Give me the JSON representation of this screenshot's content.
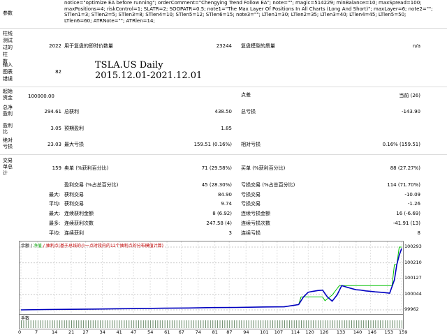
{
  "params": {
    "label": "参数",
    "text": "notice=\"optimize EA before running\"; orderComment=\"Chengying Trend Follow EA\"; note=\"\"; magic=514229; minBalance=10; maxSpread=100;\nmaxPositions=4; riskControl=1; SLATR=2; SOOPATR=0.5; note1=\"The Max Layer Of Positions In All Charts (Long And Short)\"; maxLayer=6; note2=\"\";\nSTlen1=3; STlen2=5; STlen3=8; STlen4=10; STlen5=12; STlen6=15; note3=\"\"; LTlen1=30; LTlen2=35; LTlen3=40; LTlen4=45; LTlen5=50;\nLTlen6=60; ATRNote=\"\"; ATRlen=14;"
  },
  "overlay": {
    "line1": "TSLA.US Daily",
    "line2": "2015.12.01-2021.12.01"
  },
  "rows": {
    "bars_label": "柱线\n测试\n过的\n柱\n数",
    "bars_value": "2022",
    "ticks_label": "用于复盘的即时价数量",
    "ticks_value": "23244",
    "quality_label": "复盘模型的质量",
    "quality_value": "n/a",
    "errors_label": "输入\n图表\n错误",
    "errors_value": "82",
    "deposit_label": "起始\n资金",
    "deposit_value": "100000.00",
    "spread_label": "点差",
    "spread_value": "当前 (26)",
    "net_label": "总净\n盈利",
    "net_value": "294.61",
    "gross_profit_label": "总获利",
    "gross_profit_value": "438.50",
    "gross_loss_label": "总亏损",
    "gross_loss_value": "-143.90",
    "pf_label": "盈利\n比",
    "pf_value": "3.05",
    "expected_label": "预期盈利",
    "expected_value": "1.85",
    "absdd_label": "绝对\n亏损",
    "absdd_value": "23.03",
    "maxdd_label": "最大亏损",
    "maxdd_value": "159.51 (0.16%)",
    "reldd_label": "相对亏损",
    "reldd_value": "0.16% (159.51)",
    "trades_label": "交易\n单总\n计",
    "trades_value": "159",
    "short_label": "卖单 (%获利百分比)",
    "short_value": "71 (29.58%)",
    "long_label": "买单 (%获利百分比)",
    "long_value": "88 (27.27%)",
    "profit_trades_label": "盈利交易 (%占总百分比)",
    "profit_trades_value": "45 (28.30%)",
    "loss_trades_label": "亏损交易 (%占总百分比)",
    "loss_trades_value": "114 (71.70%)",
    "largest_label": "最大:",
    "largest_profit_label": "获利交易",
    "largest_profit_value": "84.90",
    "largest_loss_label": "亏损交易",
    "largest_loss_value": "-10.09",
    "average_label": "平均:",
    "avg_profit_label": "获利交易",
    "avg_profit_value": "9.74",
    "avg_loss_label": "亏损交易",
    "avg_loss_value": "-1.26",
    "maxcons_label": "最大:",
    "maxcons_win_label": "连续获利金额",
    "maxcons_win_value": "8 (6.92)",
    "maxcons_loss_label": "连续亏损金额",
    "maxcons_loss_value": "16 (-6.69)",
    "maximal_label": "最多:",
    "maximal_win_label": "连续获利次数",
    "maximal_win_value": "247.58 (4)",
    "maximal_loss_label": "连续亏损次数",
    "maximal_loss_value": "-41.91 (13)",
    "avgcons_label": "平均:",
    "avgcons_win_label": "连续获利",
    "avgcons_win_value": "3",
    "avgcons_loss_label": "连续亏损",
    "avgcons_loss_value": "8"
  },
  "chart": {
    "legend_prefix": "余额 / ",
    "legend_equity": "净值",
    "legend_rest": " / 抽利点(基于总线的小一点时段内的12个抽利点的分布模值计算)",
    "volume_label": "手数"
  },
  "chart_data": {
    "type": "line",
    "y_ticks": [
      "100293",
      "100210",
      "100127",
      "100044",
      "99962"
    ],
    "x_ticks": [
      "0",
      "7",
      "14",
      "21",
      "27",
      "34",
      "41",
      "47",
      "54",
      "61",
      "67",
      "74",
      "81",
      "87",
      "94",
      "101",
      "107",
      "114",
      "120",
      "126",
      "133",
      "140",
      "146",
      "153",
      "159"
    ],
    "ylim": [
      99962,
      100293
    ],
    "xlim": [
      0,
      159
    ],
    "series": [
      {
        "name": "余额",
        "color": "#0000c0",
        "x": [
          0,
          10,
          20,
          30,
          40,
          50,
          60,
          70,
          80,
          90,
          100,
          110,
          116,
          118,
          120,
          122,
          124,
          126,
          128,
          130,
          132,
          134,
          136,
          138,
          140,
          142,
          144,
          146,
          148,
          150,
          152,
          154,
          156,
          157,
          158,
          159
        ],
        "y": [
          99962,
          99964,
          99965,
          99966,
          99968,
          99969,
          99971,
          99972,
          99974,
          99975,
          99977,
          99978,
          99990,
          100030,
          100055,
          100060,
          100064,
          100066,
          100030,
          100008,
          100040,
          100090,
          100082,
          100075,
          100068,
          100066,
          100062,
          100060,
          100057,
          100055,
          100053,
          100050,
          100120,
          100200,
          100250,
          100285
        ]
      },
      {
        "name": "净值",
        "color": "#00c000",
        "x": [
          0,
          10,
          20,
          30,
          40,
          50,
          60,
          70,
          80,
          90,
          100,
          110,
          116,
          117,
          120,
          126,
          127,
          130,
          133,
          134,
          140,
          146,
          152,
          155,
          156,
          157,
          158,
          159
        ],
        "y": [
          99962,
          99964,
          99965,
          99966,
          99968,
          99969,
          99971,
          99972,
          99974,
          99975,
          99977,
          99978,
          99990,
          100030,
          100030,
          100030,
          100010,
          100040,
          100090,
          100090,
          100090,
          100090,
          100090,
          100090,
          100200,
          100200,
          100293,
          100293
        ]
      }
    ]
  }
}
